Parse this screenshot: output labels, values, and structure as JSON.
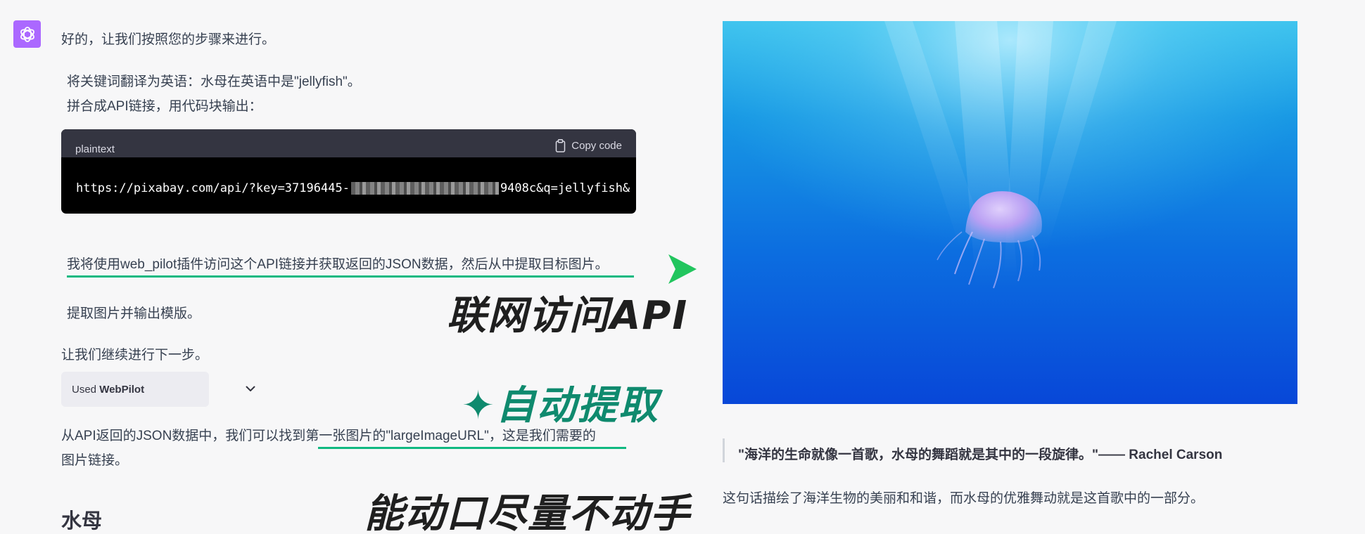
{
  "assistant": {
    "avatar_icon": "openai-logo-icon",
    "avatar_color": "#ab68ff",
    "lines": {
      "intro": "好的，让我们按照您的步骤来进行。",
      "translate": "将关键词翻译为英语：水母在英语中是\"jellyfish\"。",
      "assemble": "拼合成API链接，用代码块输出："
    },
    "code_block": {
      "language": "plaintext",
      "copy_label": "Copy code",
      "url_start": "https://pixabay.com/api/?key=37196445-",
      "url_end": "9408c&q=jellyfish&"
    },
    "plan": "我将使用web_pilot插件访问这个API链接并获取返回的JSON数据，然后从中提取目标图片。",
    "extract": "提取图片并输出模版。",
    "next_step": "让我们继续进行下一步。",
    "plugin": {
      "prefix": "Used",
      "name": "WebPilot"
    },
    "result": {
      "part1": "从API返回的JSON数据中，我们可以找到",
      "highlight": "第一张图片的\"largeImageURL\"，这是我们需要的",
      "part2": "图片链接。"
    },
    "heading": "水母"
  },
  "annotations": {
    "overlay1": "联网访问API",
    "overlay2": "✦自动提取",
    "overlay3": "能动口尽量不动手",
    "accent_color": "#10b981",
    "overlay2_color": "#0f8a6e",
    "overlay_dark_color": "#1f1f1f"
  },
  "right_panel": {
    "image_subject": "jellyfish-underwater-photo",
    "quote": "\"海洋的生命就像一首歌，水母的舞蹈就是其中的一段旋律。\"—— Rachel Carson",
    "caption": "这句话描绘了海洋生物的美丽和和谐，而水母的优雅舞动就是这首歌中的一部分。"
  }
}
